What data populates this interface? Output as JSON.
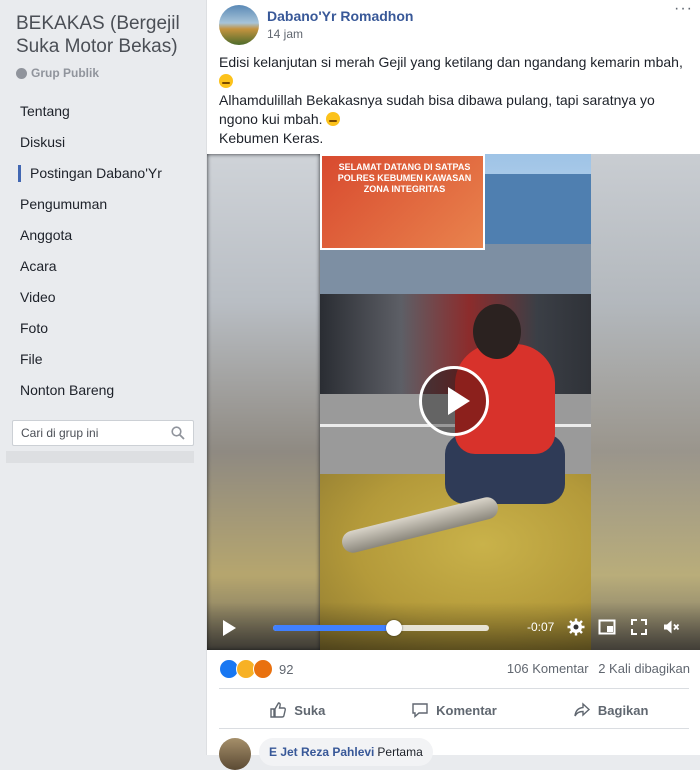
{
  "sidebar": {
    "group_name": "BEKAKAS (Bergejil Suka Motor Bekas)",
    "group_type": "Grup Publik",
    "items": [
      {
        "label": "Tentang"
      },
      {
        "label": "Diskusi"
      },
      {
        "label": "Postingan Dabano'Yr"
      },
      {
        "label": "Pengumuman"
      },
      {
        "label": "Anggota"
      },
      {
        "label": "Acara"
      },
      {
        "label": "Video"
      },
      {
        "label": "Foto"
      },
      {
        "label": "File"
      },
      {
        "label": "Nonton Bareng"
      }
    ],
    "active_index": 2,
    "search_placeholder": "Cari di grup ini"
  },
  "post": {
    "author": "Dabano'Yr Romadhon",
    "time": "14 jam",
    "text_lines": [
      "Edisi kelanjutan si merah Gejil yang ketilang dan ngandang kemarin mbah,",
      "Alhamdulillah Bekakasnya sudah bisa dibawa pulang, tapi saratnya yo ngono kui mbah.",
      "Kebumen Keras."
    ],
    "video": {
      "banner_text": "SELAMAT DATANG DI SATPAS POLRES KEBUMEN KAWASAN ZONA INTEGRITAS",
      "progress_fraction": 0.56,
      "time_remaining": "-0:07"
    },
    "reaction_count": "92",
    "comment_count": "106 Komentar",
    "share_count": "2 Kali dibagikan",
    "actions": {
      "like": "Suka",
      "comment": "Komentar",
      "share": "Bagikan"
    },
    "first_comment": {
      "name": "E Jet Reza Pahlevi",
      "badge": "Pertama"
    }
  },
  "colors": {
    "accent": "#4267b2",
    "link": "#385898",
    "progress": "#4080ff"
  }
}
